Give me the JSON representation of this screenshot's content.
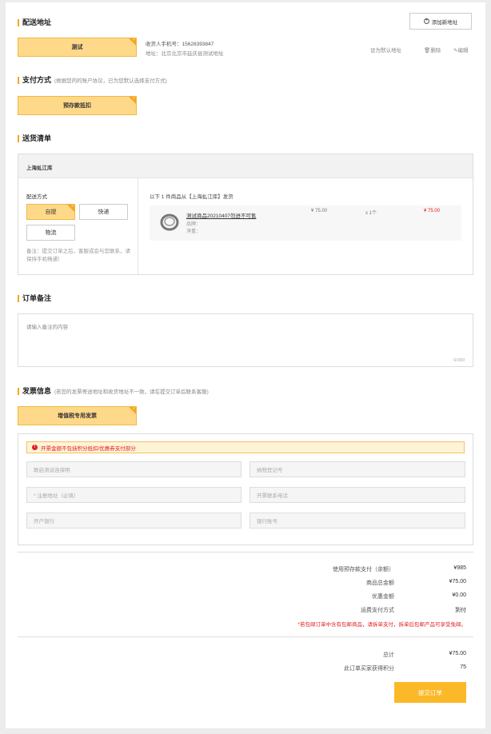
{
  "address": {
    "title": "配送地址",
    "add_button": "添加新地址",
    "selected_name": "测试",
    "phone": "收货人手机号：15628393847",
    "addr": "地址：北京北京市延庆县测试地址",
    "set_default": "设为默认地址",
    "delete": "删除",
    "edit": "编辑"
  },
  "payment": {
    "title": "支付方式",
    "subtitle": "(根据您的的账户协议，已为您默认选择支付方式)",
    "method": "预存款抵扣"
  },
  "delivery": {
    "title": "送货清单",
    "warehouse": "上海虬江库",
    "method_label": "配送方式",
    "methods": [
      "自提",
      "快递",
      "物流"
    ],
    "note": "备注：提交订单之后，客服或会与您联系，请保持手机畅通）",
    "ship_info": "以下 1 件商品从【上海虬江库】发货",
    "product": {
      "name": "测试商品20210407勿进不可售",
      "brand": "品牌：",
      "weight": "净重：",
      "unit_price": "¥ 75.00",
      "qty": "x 1个",
      "subtotal": "¥ 75.00"
    }
  },
  "remark": {
    "title": "订单备注",
    "placeholder": "请输入备注的内容",
    "count": "0/300"
  },
  "invoice": {
    "title": "发票信息",
    "subtitle": "(若您的发票寄送地址和收货地址不一致，请在提交订单后联系客服)",
    "type": "增值税专用发票",
    "warning": "开票金额不包括积分抵扣/优惠券支付部分",
    "fields": [
      "联启测试连保明",
      "纳税登记号",
      "* 注册地址（必填）",
      "开票联系电话",
      "开户银行",
      "银行账号"
    ]
  },
  "summary": {
    "rows": [
      {
        "label": "使用预存款支付（余额）",
        "value": "¥985"
      },
      {
        "label": "商品总金额",
        "value": "¥75.00"
      },
      {
        "label": "优惠金额",
        "value": "¥0.00"
      },
      {
        "label": "运费支付方式",
        "value": "到付"
      }
    ],
    "notice": "*若包邮订单中含有包邮商品，请拆单支付，拆单后包邮产品可享受免邮。",
    "total_label": "总计",
    "total_value": "¥75.00",
    "points_label": "此订单买家获得积分",
    "points_value": "75",
    "submit": "提交订单"
  },
  "colors": {
    "accent": "#f5a623",
    "selected_bg": "#ffd98a",
    "submit": "#fbb829",
    "warn": "#e02020"
  }
}
